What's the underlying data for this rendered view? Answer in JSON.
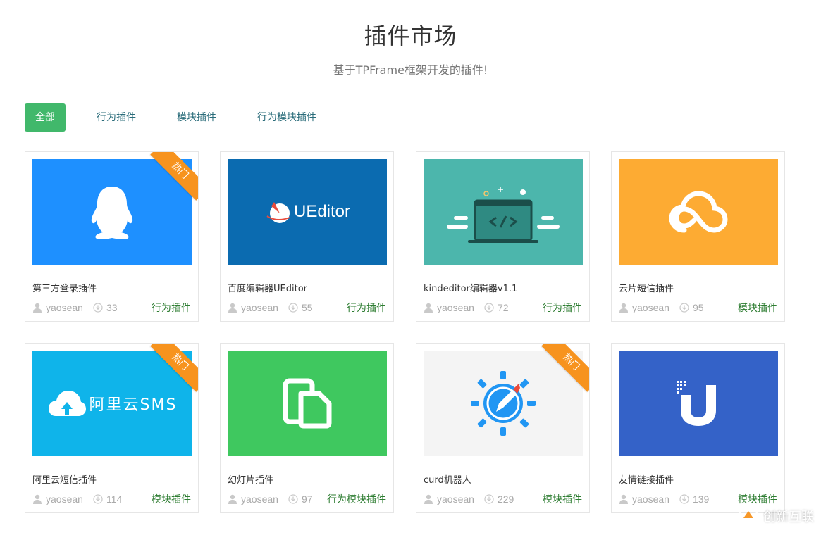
{
  "header": {
    "title": "插件市场",
    "subtitle": "基于TPFrame框架开发的插件!"
  },
  "filters": [
    {
      "label": "全部",
      "active": true
    },
    {
      "label": "行为插件",
      "active": false
    },
    {
      "label": "模块插件",
      "active": false
    },
    {
      "label": "行为模块插件",
      "active": false
    }
  ],
  "ribbon_label": "热门",
  "plugins": [
    {
      "name": "第三方登录插件",
      "author": "yaosean",
      "downloads": "33",
      "category": "行为插件",
      "hot": true,
      "thumb_color": "#1e90ff",
      "icon": "qq-penguin-icon"
    },
    {
      "name": "百度编辑器UEditor",
      "author": "yaosean",
      "downloads": "55",
      "category": "行为插件",
      "hot": false,
      "thumb_color": "#0b6bb0",
      "icon": "ueditor-logo-icon",
      "logo_text": "UEditor"
    },
    {
      "name": "kindeditor编辑器v1.1",
      "author": "yaosean",
      "downloads": "72",
      "category": "行为插件",
      "hot": false,
      "thumb_color": "#4cb6ac",
      "icon": "code-window-icon"
    },
    {
      "name": "云片短信插件",
      "author": "yaosean",
      "downloads": "95",
      "category": "模块插件",
      "hot": false,
      "thumb_color": "#fdab33",
      "icon": "cloud-icon"
    },
    {
      "name": "阿里云短信插件",
      "author": "yaosean",
      "downloads": "114",
      "category": "模块插件",
      "hot": true,
      "thumb_color": "#0fb4ea",
      "icon": "aliyun-cloud-icon",
      "logo_text": "阿里云SMS"
    },
    {
      "name": "幻灯片插件",
      "author": "yaosean",
      "downloads": "97",
      "category": "行为模块插件",
      "hot": false,
      "thumb_color": "#3fc85f",
      "icon": "slides-icon"
    },
    {
      "name": "curd机器人",
      "author": "yaosean",
      "downloads": "229",
      "category": "模块插件",
      "hot": true,
      "thumb_color": "#f4f4f4",
      "icon": "compass-pen-icon"
    },
    {
      "name": "友情链接插件",
      "author": "yaosean",
      "downloads": "139",
      "category": "模块插件",
      "hot": false,
      "thumb_color": "#3462c8",
      "icon": "u-logo-icon"
    }
  ],
  "watermark": {
    "text": "创新互联"
  }
}
